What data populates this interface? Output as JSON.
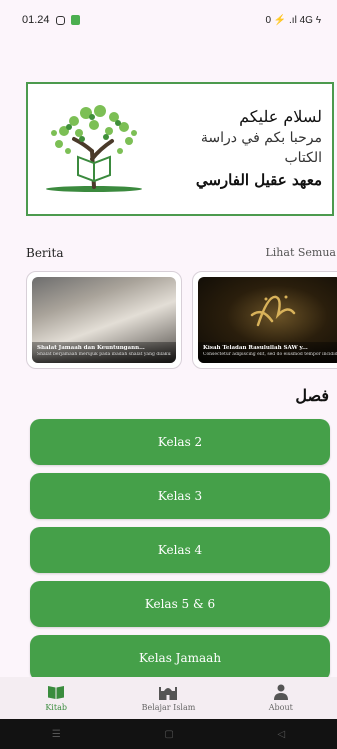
{
  "status_bar": {
    "time": "01.24",
    "indicators": "0 ⚡ .ıl 4G ϟ"
  },
  "banner": {
    "line1": "لسلام عليكم",
    "line2": "مرحبا بكم في دراسة",
    "line3": "الكتاب",
    "line4": "معهد عقيل الفارسي",
    "border_color": "#4c9a4e"
  },
  "news": {
    "heading": "Berita",
    "see_all": "Lihat Semua",
    "items": [
      {
        "title": "Shalat Jamaah dan Keuntungann...",
        "desc": "Shalat berjamaah merujuk pada ibadah shalat yang dilakukan secara bersama-sama..."
      },
      {
        "title": "Kisah Teladan Rasulullah SAW y...",
        "desc": "Consectetur adipiscing elit, sed do eiusmod tempor incididunt ut labore et dolore magna..."
      }
    ]
  },
  "classes": {
    "heading": "فصل",
    "items": [
      "Kelas 2",
      "Kelas 3",
      "Kelas 4",
      "Kelas 5 & 6",
      "Kelas Jamaah"
    ],
    "color": "#45a049"
  },
  "bottom_nav": {
    "items": [
      {
        "label": "Kitab",
        "icon": "book-icon"
      },
      {
        "label": "Belajar Islam",
        "icon": "mosque-icon"
      },
      {
        "label": "About",
        "icon": "person-icon"
      }
    ],
    "active_color": "#3a8c3e"
  },
  "system_nav": {
    "items": [
      "menu-icon",
      "home-icon",
      "back-icon"
    ]
  }
}
